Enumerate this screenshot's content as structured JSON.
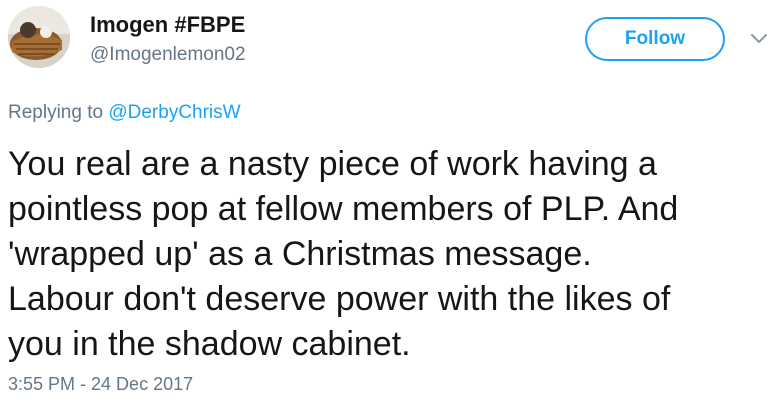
{
  "user": {
    "display_name": "Imogen #FBPE",
    "handle": "@Imogenlemon02",
    "avatar_icon": "profile-photo"
  },
  "follow": {
    "label": "Follow",
    "color": "#1da1f2"
  },
  "menu": {
    "icon": "chevron-down-icon"
  },
  "reply": {
    "prefix": "Replying to",
    "mention": "@DerbyChrisW"
  },
  "tweet": {
    "lines": [
      "You real are a nasty piece of work having a",
      "pointless pop at fellow members of PLP. And",
      "'wrapped up' as a Christmas message.",
      "Labour don't deserve power with the likes of",
      "you in the shadow cabinet."
    ],
    "timestamp": "3:55 PM - 24 Dec 2017"
  },
  "colors": {
    "text": "#14171a",
    "secondary": "#657786",
    "accent": "#1da1f2"
  }
}
